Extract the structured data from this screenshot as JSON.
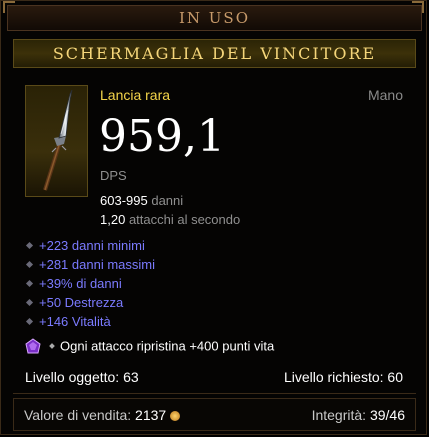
{
  "header": {
    "status": "IN USO"
  },
  "item": {
    "name": "SCHERMAGLIA DEL VINCITORE",
    "type": "Lancia rara",
    "slot": "Mano",
    "dps_value": "959,1",
    "dps_label": "DPS",
    "damage_range": "603-995",
    "damage_suffix": "danni",
    "attack_speed": "1,20",
    "attack_speed_suffix": "attacchi al secondo",
    "affixes": [
      "+223 danni minimi",
      "+281 danni massimi",
      "+39% di danni",
      "+50 Destrezza",
      "+146 Vitalità"
    ],
    "gem_effect": "Ogni attacco ripristina +400 punti vita",
    "item_level_label": "Livello oggetto: 63",
    "required_level_label": "Livello richiesto: 60"
  },
  "footer": {
    "vendor_label": "Valore di vendita:",
    "vendor_value": "2137",
    "durability_label": "Integrità:",
    "durability_value": "39/46"
  },
  "colors": {
    "rare_yellow": "#f4d54a",
    "affix_blue": "#7b7bff",
    "header_text": "#c79a6a"
  },
  "icons": [
    "spear-item-icon",
    "amethyst-gem-icon",
    "gold-coin-icon"
  ]
}
